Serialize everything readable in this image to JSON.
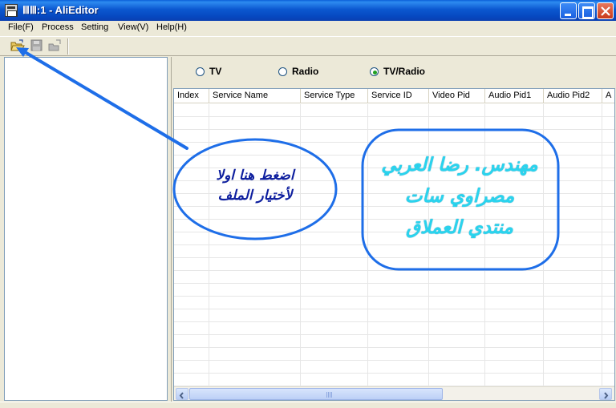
{
  "window": {
    "title": "ⅢⅢ:1 - AliEditor"
  },
  "menu": {
    "items": [
      "File(F)",
      "Process",
      "Setting",
      "View(V)",
      "Help(H)"
    ]
  },
  "toolbar": {
    "icons": [
      "open-folder-icon",
      "save-disk-icon",
      "save-as-icon"
    ]
  },
  "filter": {
    "options": [
      {
        "label": "TV",
        "checked": false
      },
      {
        "label": "Radio",
        "checked": false
      },
      {
        "label": "TV/Radio",
        "checked": true
      }
    ]
  },
  "table": {
    "columns": [
      "Index",
      "Service Name",
      "Service Type",
      "Service ID",
      "Video Pid",
      "Audio Pid1",
      "Audio Pid2",
      "A"
    ],
    "rows": []
  },
  "annotations": {
    "left_callout": {
      "lines": [
        "اضغط هنا اولا",
        "لأختيار الملف"
      ],
      "color": "#0d1e9e",
      "outline_color": "#1e6ee8"
    },
    "right_callout": {
      "lines": [
        "مهندس. رضا العربي",
        "مصراوي سات",
        "منتدي العملاق"
      ],
      "color": "#29d4ee",
      "outline_color": "#1e6ee8"
    }
  },
  "colors": {
    "titlebar": "#0b58d0",
    "chrome": "#ece9d8",
    "annotation_blue": "#1e6ee8"
  }
}
